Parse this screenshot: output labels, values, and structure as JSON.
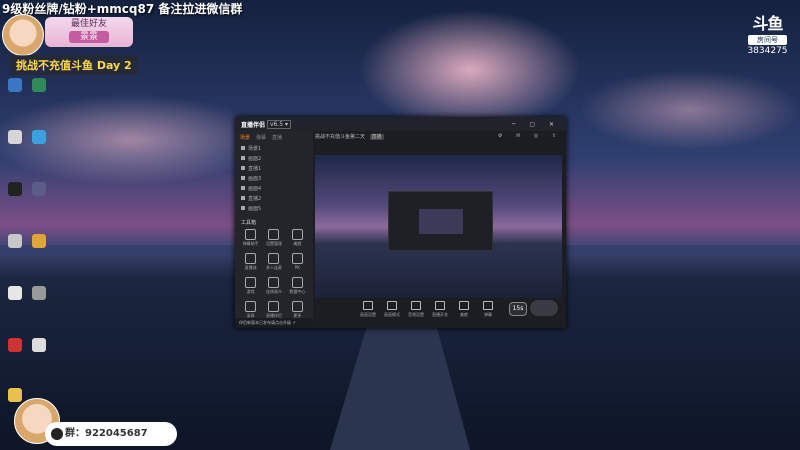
{
  "overlay": {
    "banner": "9级粉丝牌/钻粉+mmcq87 备注拉进微信群",
    "ribbon_title": "最佳好友",
    "ribbon_name": "景景",
    "challenge": "挑战不充值斗鱼 Day 2",
    "logo_room_label": "房间号",
    "room_number": "3834275",
    "qq_label": "群：",
    "qq_number": "922045687"
  },
  "obs": {
    "brand": "直播伴侣",
    "version": "v6.5 ▾",
    "tabs": [
      "场景",
      "弹幕",
      "直播"
    ],
    "scenes": [
      "场景1",
      "画面2",
      "直播1",
      "画面3",
      "画面4",
      "直播2",
      "画面5"
    ],
    "tools_title": "工具箱",
    "tools": [
      "弹幕助手",
      "设置管理",
      "美颜",
      "直播流",
      "多人连麦",
      "PK",
      "游戏",
      "连线观众",
      "数据中心",
      "录屏",
      "直播伴侣",
      "更多"
    ],
    "notice": "伴侣新版本已发布请点击升级 ↗",
    "room_title": "挑战不充值斗鱼第二天",
    "room_tag": "直播",
    "bottom_buttons": [
      "画面设置",
      "画面模式",
      "音频设置",
      "直播开关",
      "美颜",
      "弹幕"
    ],
    "badge": "15s"
  },
  "colors": {
    "accent": "#ff7a1a",
    "challenge_text": "#ffd84d"
  }
}
